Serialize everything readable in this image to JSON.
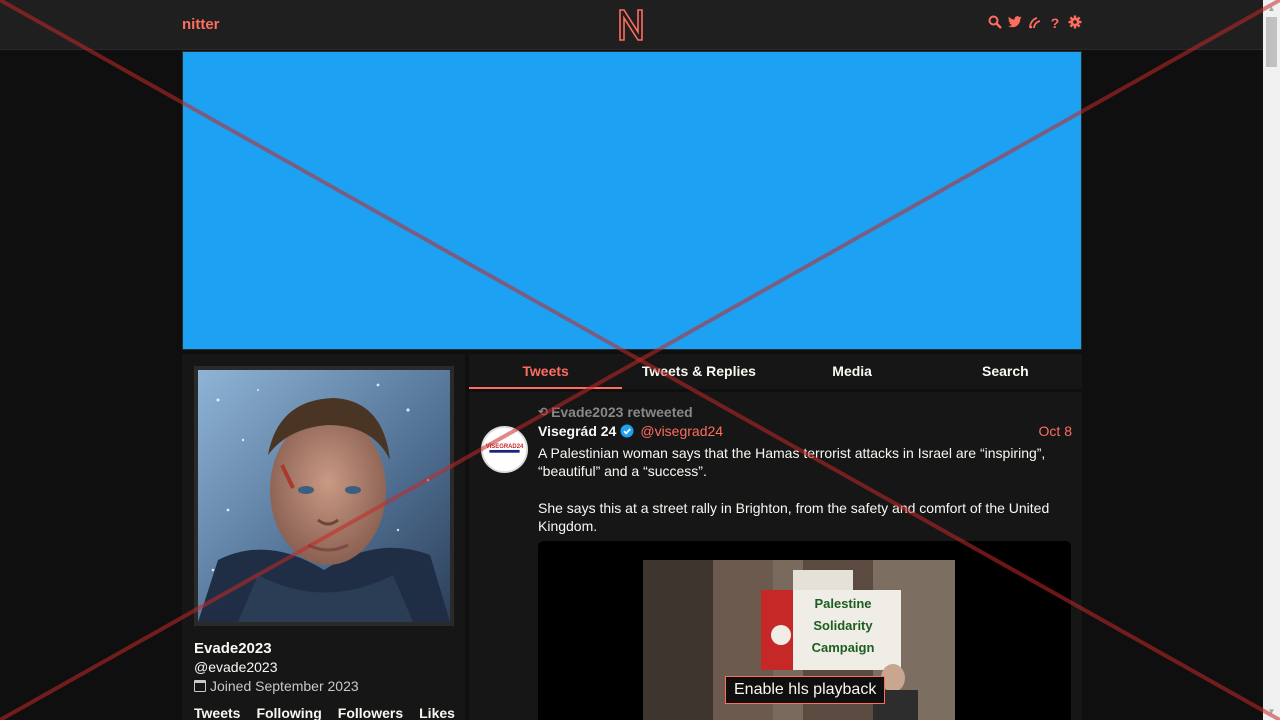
{
  "nav": {
    "brand": "nitter",
    "icons": [
      "search-icon",
      "twitter-bird-icon",
      "rss-icon",
      "help-icon",
      "gear-icon"
    ],
    "help_glyph": "?"
  },
  "profile": {
    "fullname": "Evade2023",
    "username": "@evade2023",
    "joined": "Joined September 2023",
    "stats": [
      "Tweets",
      "Following",
      "Followers",
      "Likes"
    ]
  },
  "tabs": [
    {
      "label": "Tweets",
      "active": true
    },
    {
      "label": "Tweets & Replies",
      "active": false
    },
    {
      "label": "Media",
      "active": false
    },
    {
      "label": "Search",
      "active": false
    }
  ],
  "tweet": {
    "retweet_header": "Evade2023 retweeted",
    "fullname": "Visegrád 24",
    "username": "@visegrad24",
    "date": "Oct 8",
    "avatar_text": "VISEGRAD24",
    "paragraphs": [
      "A Palestinian woman says that the Hamas terrorist attacks in Israel are “inspiring”, “beautiful” and a “success”.",
      "She says this at a street rally in Brighton, from the safety and comfort of the United Kingdom."
    ],
    "sign_lines": [
      "Palestine",
      "Solidarity",
      "Campaign"
    ],
    "play_label": "Enable hls playback"
  },
  "colors": {
    "accent": "#ff6c60",
    "background": "#0f0f0f",
    "panel": "#161616",
    "banner": "#1da1f2",
    "verified": "#1da1f2"
  }
}
